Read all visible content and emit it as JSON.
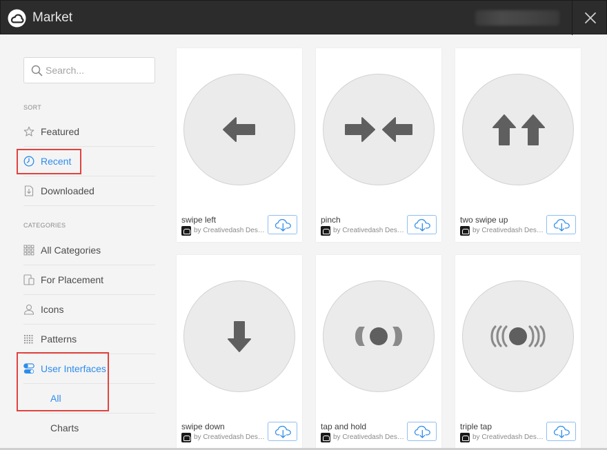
{
  "window": {
    "title": "Market",
    "close_icon": "close-icon"
  },
  "sidebar": {
    "search": {
      "placeholder": "Search...",
      "value": ""
    },
    "sort_label": "SORT",
    "sort_items": [
      {
        "label": "Featured",
        "icon": "star-icon",
        "active": false
      },
      {
        "label": "Recent",
        "icon": "clock-icon",
        "active": true
      },
      {
        "label": "Downloaded",
        "icon": "download-file-icon",
        "active": false
      }
    ],
    "categories_label": "CATEGORIES",
    "category_items": [
      {
        "label": "All Categories",
        "icon": "grid-icon",
        "active": false
      },
      {
        "label": "For Placement",
        "icon": "devices-icon",
        "active": false
      },
      {
        "label": "Icons",
        "icon": "person-icon",
        "active": false
      },
      {
        "label": "Patterns",
        "icon": "pattern-icon",
        "active": false
      },
      {
        "label": "User Interfaces",
        "icon": "toggles-icon",
        "active": true
      }
    ],
    "sub_items": [
      {
        "label": "All",
        "active": true
      },
      {
        "label": "Charts",
        "active": false
      }
    ]
  },
  "cards": [
    {
      "title": "swipe left",
      "author": "by Creativedash Desig...",
      "glyph": "arrow-left-icon"
    },
    {
      "title": "pinch",
      "author": "by Creativedash Desig...",
      "glyph": "pinch-arrows-icon"
    },
    {
      "title": "two swipe up",
      "author": "by Creativedash Desig...",
      "glyph": "two-arrows-up-icon"
    },
    {
      "title": "swipe down",
      "author": "by Creativedash Desig...",
      "glyph": "arrow-down-icon"
    },
    {
      "title": "tap and hold",
      "author": "by Creativedash Desig...",
      "glyph": "tap-hold-icon"
    },
    {
      "title": "triple tap",
      "author": "by Creativedash Desig...",
      "glyph": "triple-tap-icon"
    }
  ],
  "colors": {
    "titlebar": "#2c2c2c",
    "accent": "#2d8ceb",
    "highlight": "#e0423f",
    "glyph": "#5f5f5f"
  }
}
